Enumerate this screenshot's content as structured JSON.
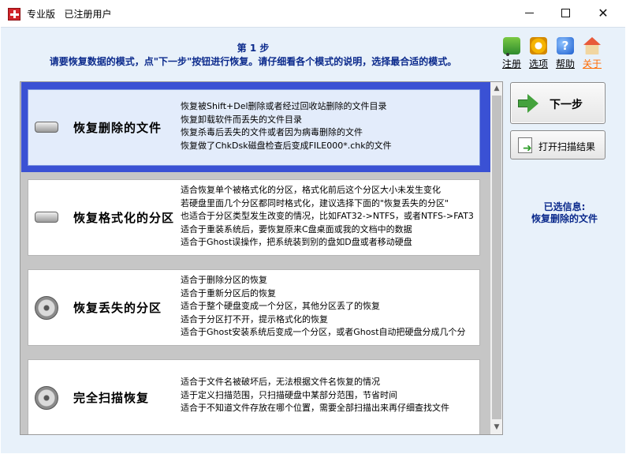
{
  "window": {
    "title_main": "专业版",
    "title_status": "已注册用户"
  },
  "header": {
    "step": "第 1 步",
    "instruction": "请要恢复数据的模式，点\"下一步\"按钮进行恢复。请仔细看各个模式的说明，选择最合适的模式。"
  },
  "toolbar": {
    "register": "注册",
    "options": "选项",
    "help": "帮助",
    "about": "关于"
  },
  "modes": [
    {
      "title": "恢复删除的文件",
      "icon": "hard-drive-icon",
      "selected": true,
      "lines": [
        "恢复被Shift+Del删除或者经过回收站删除的文件目录",
        "恢复卸载软件而丢失的文件目录",
        "恢复杀毒后丢失的文件或者因为病毒删除的文件",
        "恢复做了ChkDsk磁盘检查后变成FILE000*.chk的文件"
      ]
    },
    {
      "title": "恢复格式化的分区",
      "icon": "hard-drive-icon",
      "selected": false,
      "lines": [
        "适合恢复单个被格式化的分区，格式化前后这个分区大小未发生变化",
        "若硬盘里面几个分区都同时格式化，建议选择下面的\"恢复丢失的分区\"",
        "也适合于分区类型发生改变的情况，比如FAT32->NTFS，或者NTFS->FAT3",
        "适合于重装系统后，要恢复原来C盘桌面或我的文档中的数据",
        "适合于Ghost误操作，把系统装到别的盘如D盘或者移动硬盘"
      ]
    },
    {
      "title": "恢复丢失的分区",
      "icon": "disk-platter-icon",
      "selected": false,
      "lines": [
        "适合于删除分区的恢复",
        "适合于重新分区后的恢复",
        "适合于整个硬盘变成一个分区，其他分区丢了的恢复",
        "适合于分区打不开，提示格式化的恢复",
        "适合于Ghost安装系统后变成一个分区，或者Ghost自动把硬盘分成几个分"
      ]
    },
    {
      "title": "完全扫描恢复",
      "icon": "disk-platter-icon",
      "selected": false,
      "lines": [
        "适合于文件名被破坏后，无法根据文件名恢复的情况",
        "适于定义扫描范围，只扫描硬盘中某部分范围，节省时间",
        "适合于不知道文件存放在哪个位置，需要全部扫描出来再仔细查找文件"
      ]
    }
  ],
  "actions": {
    "next": "下一步",
    "open_results": "打开扫描结果"
  },
  "selection": {
    "label": "已选信息:",
    "value": "恢复删除的文件"
  },
  "colors": {
    "selected_border": "#3a51d4",
    "heading_text": "#0b2a8c",
    "about_link": "#ff6a00"
  }
}
